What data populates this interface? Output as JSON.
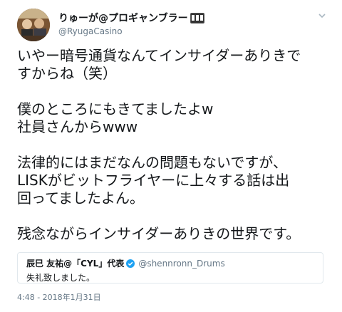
{
  "author": {
    "display_name": "りゅーが@プロギャンブラー",
    "handle": "@RyugaCasino",
    "avatar_icon": "user-avatar",
    "badge_icon": "slot-machine-icon"
  },
  "tweet": {
    "paragraphs": [
      "いやー暗号通貨なんてインサイダーありきで\nすからね（笑）",
      "僕のところにもきてましたよw\n社員さんからwww",
      "法律的にはまだなんの問題もないですが、\nLISKがビットフライヤーに上々する話は出\n回ってましたよん。",
      "残念ながらインサイダーありきの世界です。"
    ],
    "timestamp": "4:48 - 2018年1月31日"
  },
  "quoted_tweet": {
    "display_name": "辰巳 友祐@「CYL」代表",
    "handle": "@shennronn_Drums",
    "text": "失礼致しました。",
    "verified_icon": "verified-badge-icon"
  },
  "colors": {
    "text": "#14171a",
    "secondary": "#657786",
    "verified": "#1da1f2",
    "border": "#e1e8ed"
  }
}
